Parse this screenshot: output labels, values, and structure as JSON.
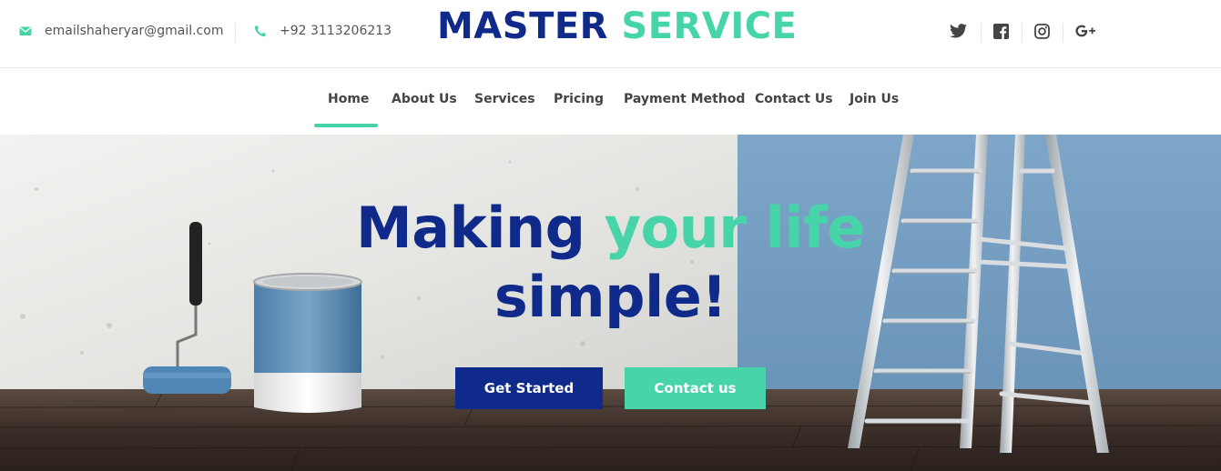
{
  "topbar": {
    "email": "emailshaheryar@gmail.com",
    "phone": "+92 3113206213",
    "email_icon": "envelope-icon",
    "phone_icon": "phone-icon"
  },
  "brand": {
    "word1": "MASTER",
    "word2": "SERVICE"
  },
  "social": [
    {
      "name": "twitter-icon"
    },
    {
      "name": "facebook-icon"
    },
    {
      "name": "instagram-icon"
    },
    {
      "name": "google-plus-icon"
    }
  ],
  "nav": {
    "items": [
      "Home",
      "About Us",
      "Services",
      "Pricing",
      "Payment Method",
      "Contact Us",
      "Join Us"
    ],
    "active": "Home"
  },
  "hero": {
    "line1_a": "Making",
    "line1_b": "your life",
    "line2": "simple!",
    "primary_button": "Get Started",
    "secondary_button": "Contact us"
  },
  "colors": {
    "navy": "#0f2a8a",
    "mint": "#47d4a9"
  }
}
